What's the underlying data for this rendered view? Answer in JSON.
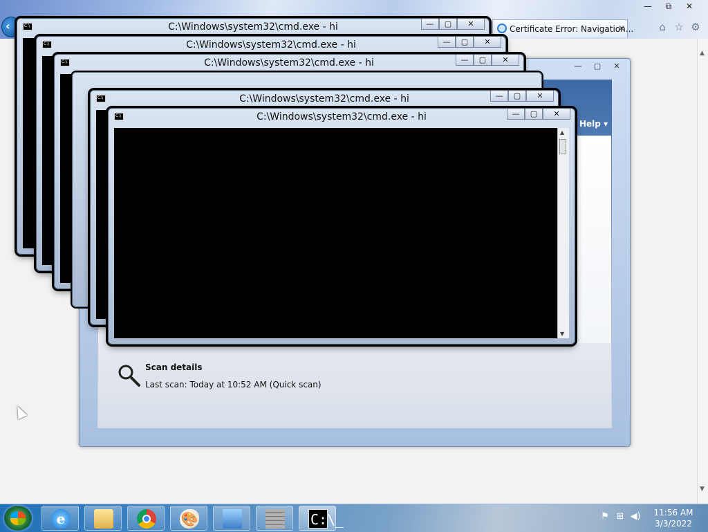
{
  "browser": {
    "tab_title": "Certificate Error: Navigation...",
    "tab_close": "✕",
    "window_buttons": [
      "—",
      "⧉",
      "✕"
    ],
    "tool_icons": [
      "home-icon",
      "star-icon",
      "gear-icon"
    ]
  },
  "defender": {
    "window_buttons": [
      "—",
      "▢",
      "✕"
    ],
    "help_label": "Help ▾",
    "scan_title": "Scan details",
    "last_scan": "Last scan:  Today at 10:52 AM (Quick scan)"
  },
  "cmd_windows": [
    {
      "title": "C:\\Windows\\system32\\cmd.exe - hi"
    },
    {
      "title": "C:\\Windows\\system32\\cmd.exe - hi"
    },
    {
      "title": "C:\\Windows\\system32\\cmd.exe - hi"
    },
    {
      "title": "C:\\Windows\\system32\\cmd.exe - hi"
    },
    {
      "title": "C:\\Windows\\system32\\cmd.exe - hi"
    }
  ],
  "cmd_buttons": [
    "—",
    "▢",
    "✕"
  ],
  "taskbar": {
    "items": [
      {
        "name": "internet-explorer",
        "icon": "ie-icon",
        "glyph": "e"
      },
      {
        "name": "file-explorer",
        "icon": "folder-icon",
        "glyph": ""
      },
      {
        "name": "chrome",
        "icon": "chrome-icon",
        "glyph": ""
      },
      {
        "name": "paint",
        "icon": "paint-icon",
        "glyph": "🎨"
      },
      {
        "name": "remote-desktop",
        "icon": "remote-desktop-icon",
        "glyph": ""
      },
      {
        "name": "firewall",
        "icon": "firewall-icon",
        "glyph": ""
      },
      {
        "name": "command-prompt",
        "icon": "cmd-icon",
        "glyph": "C:\\_"
      }
    ],
    "tray_icons": [
      "flag-icon",
      "network-icon",
      "volume-icon"
    ],
    "clock_time": "11:56 AM",
    "clock_date": "3/3/2022"
  }
}
